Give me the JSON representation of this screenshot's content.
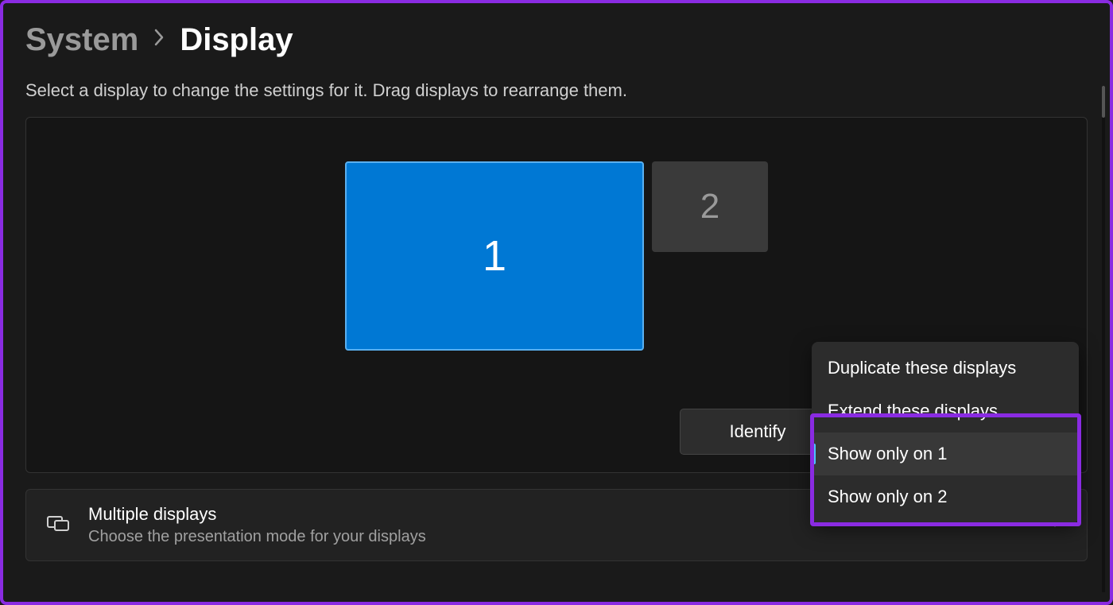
{
  "breadcrumb": {
    "parent": "System",
    "current": "Display"
  },
  "instruction": "Select a display to change the settings for it. Drag displays to rearrange them.",
  "monitors": {
    "primary_label": "1",
    "secondary_label": "2"
  },
  "identify_button": "Identify",
  "dropdown": {
    "items": [
      {
        "label": "Duplicate these displays"
      },
      {
        "label": "Extend these displays"
      },
      {
        "label": "Show only on 1"
      },
      {
        "label": "Show only on 2"
      }
    ],
    "selected_index": 2
  },
  "multiple_displays_row": {
    "title": "Multiple displays",
    "subtitle": "Choose the presentation mode for your displays"
  }
}
